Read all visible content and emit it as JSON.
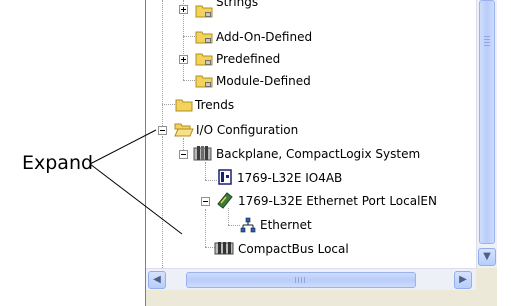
{
  "tree": {
    "items": [
      {
        "label": "Strings"
      },
      {
        "label": "Add-On-Defined"
      },
      {
        "label": "Predefined"
      },
      {
        "label": "Module-Defined"
      },
      {
        "label": "Trends"
      },
      {
        "label": "I/O Configuration"
      },
      {
        "label": "Backplane, CompactLogix System"
      },
      {
        "label": "1769-L32E IO4AB"
      },
      {
        "label": "1769-L32E Ethernet Port LocalEN"
      },
      {
        "label": "Ethernet"
      },
      {
        "label": "CompactBus Local"
      }
    ]
  },
  "callout": {
    "label": "Expand"
  },
  "colors": {
    "folder": "#f2d45c",
    "scrollbar_thumb": "#b9cdfa",
    "chassis": "#3b7b3b"
  }
}
